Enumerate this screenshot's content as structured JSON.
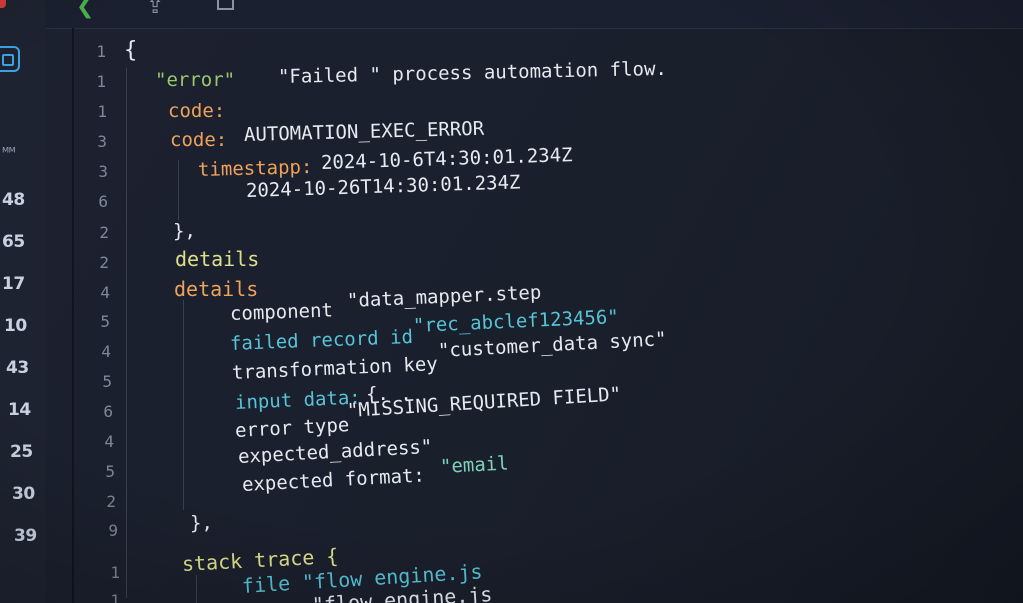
{
  "colors": {
    "background": "#1a1f2b",
    "accent_blue": "#3ea3e6",
    "toolbar_green": "#4caf50",
    "error_red": "#d93b3b"
  },
  "toolbar": {
    "icons": [
      "back-chevron-icon",
      "upload-arrow-icon",
      "copy-icon"
    ]
  },
  "side_panel": {
    "items": [
      "ᴹᴹ",
      "48",
      "65",
      "17",
      "10",
      "43",
      "14",
      "25",
      "30",
      "39"
    ]
  },
  "gutter": {
    "line_numbers": [
      "1",
      "1",
      "1",
      "3",
      "3",
      "6",
      "2",
      "2",
      "4",
      "5",
      "4",
      "5",
      "6",
      "4",
      "5",
      "2",
      "9",
      "1",
      "1"
    ]
  },
  "code": {
    "open_brace": "{",
    "error_key": "\"error\"",
    "error_value": "\"Failed \" process automation flow.",
    "code_key_1": "code:",
    "code_key_2": "code:",
    "code_value": "AUTOMATION_EXEC_ERROR",
    "timestamp_key": "timestapp:",
    "timestamp_value_1": "2024-10-6T4:30:01.234Z",
    "timestamp_value_2": "2024-10-26T14:30:01.234Z",
    "close_brace_1": "},",
    "details_1": "details",
    "details_2": "details",
    "component_key": "component",
    "component_value": "\"data_mapper.step",
    "failed_record_key": "failed record id",
    "failed_record_value": "\"rec_abclef123456\"",
    "transformation_key": "transformation key",
    "transformation_value": "\"customer_data sync\"",
    "input_data_key": "input data:",
    "input_data_value": "{. .",
    "error_type_key": "error type",
    "error_type_value": "\"MISSING_REQUIRED FIELD\"",
    "expected_address": "expected_address\"",
    "expected_format_key": "expected format:",
    "expected_format_value": "\"email",
    "close_brace_2": "},",
    "stack_trace": "stack trace {",
    "file_line_1": "file \"flow engine.js",
    "file_line_2": "\"flow engine.js"
  }
}
